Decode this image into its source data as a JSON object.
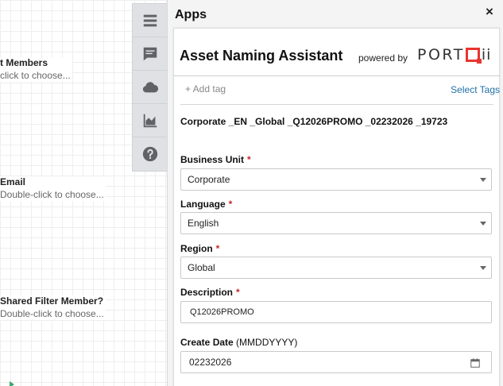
{
  "canvas": {
    "nodes": [
      {
        "title": "t Members",
        "subtitle": "click to choose..."
      },
      {
        "title": "Email",
        "subtitle": "Double-click to choose..."
      },
      {
        "title": "Shared Filter Member?",
        "subtitle": "Double-click to choose..."
      }
    ]
  },
  "toolbar": {
    "items": [
      {
        "icon": "menu-icon"
      },
      {
        "icon": "comment-icon"
      },
      {
        "icon": "cloud-icon"
      },
      {
        "icon": "area-chart-icon"
      },
      {
        "icon": "help-icon"
      }
    ]
  },
  "panel": {
    "title": "Apps",
    "close_glyph": "×",
    "card": {
      "title": "Asset Naming Assistant",
      "powered_by": "powered by",
      "brand": {
        "prefix": "PORT",
        "suffix": "ii",
        "accent_color": "#e8352e"
      },
      "add_tag": "+ Add tag",
      "select_tags": "Select Tags",
      "generated_name": "Corporate _EN _Global _Q12026PROMO _02232026 _19723",
      "fields": {
        "business_unit": {
          "label": "Business Unit",
          "required": "*",
          "value": "Corporate"
        },
        "language": {
          "label": "Language",
          "required": "*",
          "value": "English"
        },
        "region": {
          "label": "Region",
          "required": "*",
          "value": "Global"
        },
        "description": {
          "label": "Description",
          "required": "*",
          "value": "Q12026PROMO"
        },
        "create_date": {
          "label": "Create Date",
          "hint": "(MMDDYYYY)",
          "value": "02232026"
        }
      }
    }
  },
  "colors": {
    "link": "#1f6fa8",
    "required": "#c62828",
    "toolbar_bg": "#dfe1e4"
  }
}
